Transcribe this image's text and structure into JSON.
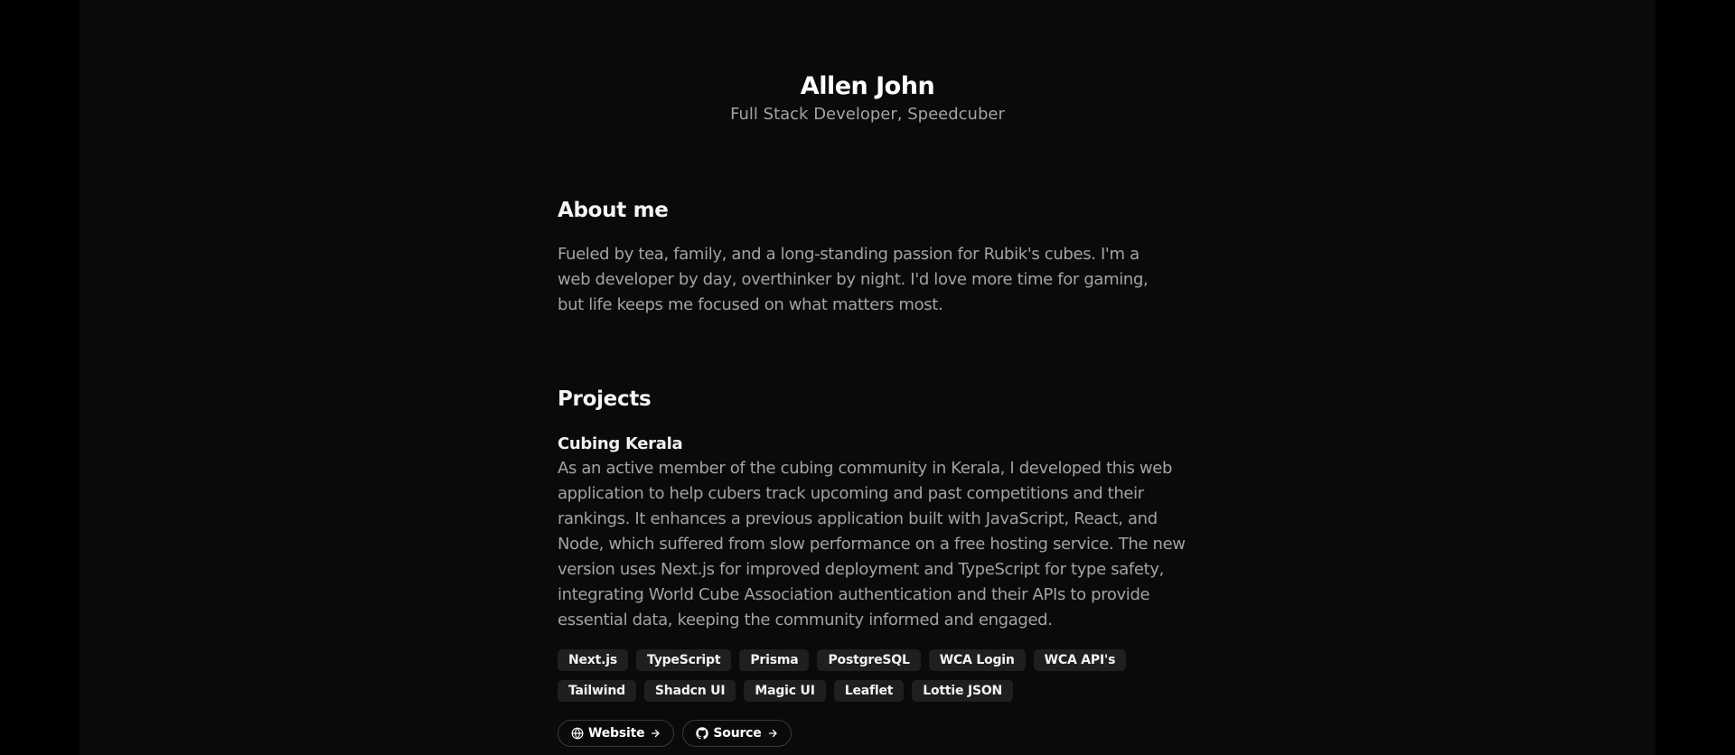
{
  "header": {
    "name": "Allen John",
    "role": "Full Stack Developer, Speedcuber"
  },
  "about": {
    "title": "About me",
    "text": "Fueled by tea, family, and a long-standing passion for Rubik's cubes. I'm a web developer by day, overthinker by night. I'd love more time for gaming, but life keeps me focused on what matters most."
  },
  "projects": {
    "title": "Projects",
    "items": [
      {
        "name": "Cubing Kerala",
        "description": "As an active member of the cubing community in Kerala, I developed this web application to help cubers track upcoming and past competitions and their rankings. It enhances a previous application built with JavaScript, React, and Node, which suffered from slow performance on a free hosting service. The new version uses Next.js for improved deployment and TypeScript for type safety, integrating World Cube Association authentication and their APIs to provide essential data, keeping the community informed and engaged.",
        "tags": [
          "Next.js",
          "TypeScript",
          "Prisma",
          "PostgreSQL",
          "WCA Login",
          "WCA API's",
          "Tailwind",
          "Shadcn UI",
          "Magic UI",
          "Leaflet",
          "Lottie JSON"
        ],
        "links": [
          {
            "label": "Website",
            "icon": "globe-icon"
          },
          {
            "label": "Source",
            "icon": "github-icon"
          }
        ]
      }
    ]
  },
  "colors": {
    "outer_background": "#000000",
    "page_background": "#0a0a0a",
    "heading": "#ffffff",
    "muted_text": "#a3a3a3",
    "tag_background": "#1f1f1f",
    "button_border": "#3a3a3a"
  }
}
